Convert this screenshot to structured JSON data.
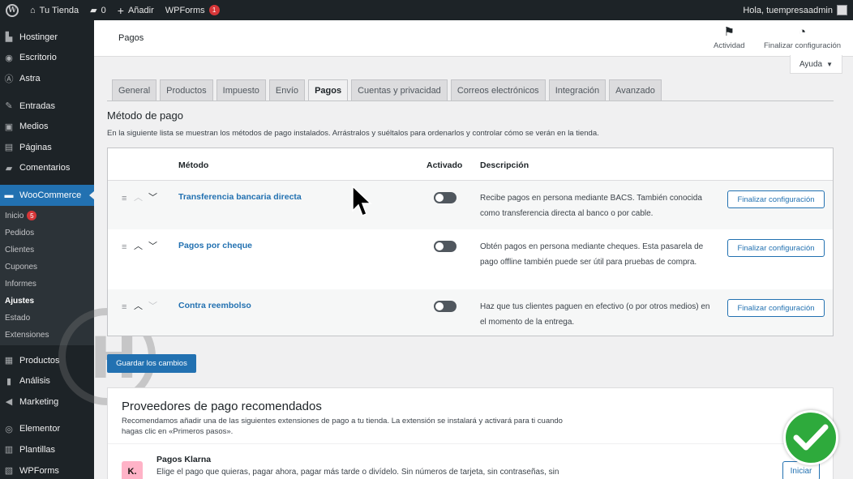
{
  "adminbar": {
    "site_name": "Tu Tienda",
    "comments_count": "0",
    "add_new": "Añadir",
    "wpforms": "WPForms",
    "wpforms_badge": "1",
    "greeting": "Hola, tuempresaadmin"
  },
  "sidebar": {
    "items_top": [
      {
        "label": "Hostinger",
        "icon": "hostinger-icon"
      },
      {
        "label": "Escritorio",
        "icon": "dashboard-icon"
      },
      {
        "label": "Astra",
        "icon": "astra-icon"
      },
      {
        "label": "Entradas",
        "icon": "pin-icon"
      },
      {
        "label": "Medios",
        "icon": "media-icon"
      },
      {
        "label": "Páginas",
        "icon": "pages-icon"
      },
      {
        "label": "Comentarios",
        "icon": "comments-icon"
      }
    ],
    "woocommerce": "WooCommerce",
    "submenu": [
      {
        "label": "Inicio",
        "badge": "5"
      },
      {
        "label": "Pedidos"
      },
      {
        "label": "Clientes"
      },
      {
        "label": "Cupones"
      },
      {
        "label": "Informes"
      },
      {
        "label": "Ajustes"
      },
      {
        "label": "Estado"
      },
      {
        "label": "Extensiones"
      }
    ],
    "items_bottom": [
      {
        "label": "Productos",
        "icon": "products-icon"
      },
      {
        "label": "Análisis",
        "icon": "analytics-icon"
      },
      {
        "label": "Marketing",
        "icon": "marketing-icon"
      },
      {
        "label": "Elementor",
        "icon": "elementor-icon"
      },
      {
        "label": "Plantillas",
        "icon": "templates-icon"
      },
      {
        "label": "WPForms",
        "icon": "wpforms-icon"
      }
    ]
  },
  "header": {
    "title": "Pagos",
    "activity": "Actividad",
    "finish_setup": "Finalizar configuración",
    "help": "Ayuda"
  },
  "tabs": [
    "General",
    "Productos",
    "Impuesto",
    "Envío",
    "Pagos",
    "Cuentas y privacidad",
    "Correos electrónicos",
    "Integración",
    "Avanzado"
  ],
  "active_tab": "Pagos",
  "section": {
    "title": "Método de pago",
    "description": "En la siguiente lista se muestran los métodos de pago instalados. Arrástralos y suéltalos para ordenarlos y controlar cómo se verán en la tienda."
  },
  "table": {
    "headers": {
      "method": "Método",
      "enabled": "Activado",
      "description": "Descripción"
    },
    "rows": [
      {
        "name": "Transferencia bancaria directa",
        "enabled": false,
        "description": "Recibe pagos en persona mediante BACS. También conocida como transferencia directa al banco o por cable.",
        "button": "Finalizar configuración"
      },
      {
        "name": "Pagos por cheque",
        "enabled": false,
        "description": "Obtén pagos en persona mediante cheques. Esta pasarela de pago offline también puede ser útil para pruebas de compra.",
        "button": "Finalizar configuración"
      },
      {
        "name": "Contra reembolso",
        "enabled": false,
        "description": "Haz que tus clientes paguen en efectivo (o por otros medios) en el momento de la entrega.",
        "button": "Finalizar configuración"
      }
    ]
  },
  "save_button": "Guardar los cambios",
  "recommended": {
    "title": "Proveedores de pago recomendados",
    "description": "Recomendamos añadir una de las siguientes extensiones de pago a tu tienda. La extensión se instalará y activará para ti cuando hagas clic en «Primeros pasos».",
    "provider_name": "Pagos Klarna",
    "provider_logo": "K.",
    "provider_desc": "Elige el pago que quieras, pagar ahora, pagar más tarde o divídelo. Sin números de tarjeta, sin contraseñas, sin",
    "start_button": "Iniciar"
  },
  "colors": {
    "accent": "#2271b1",
    "sidebar": "#1d2327",
    "badge": "#d63638",
    "check": "#2eaa3c"
  }
}
